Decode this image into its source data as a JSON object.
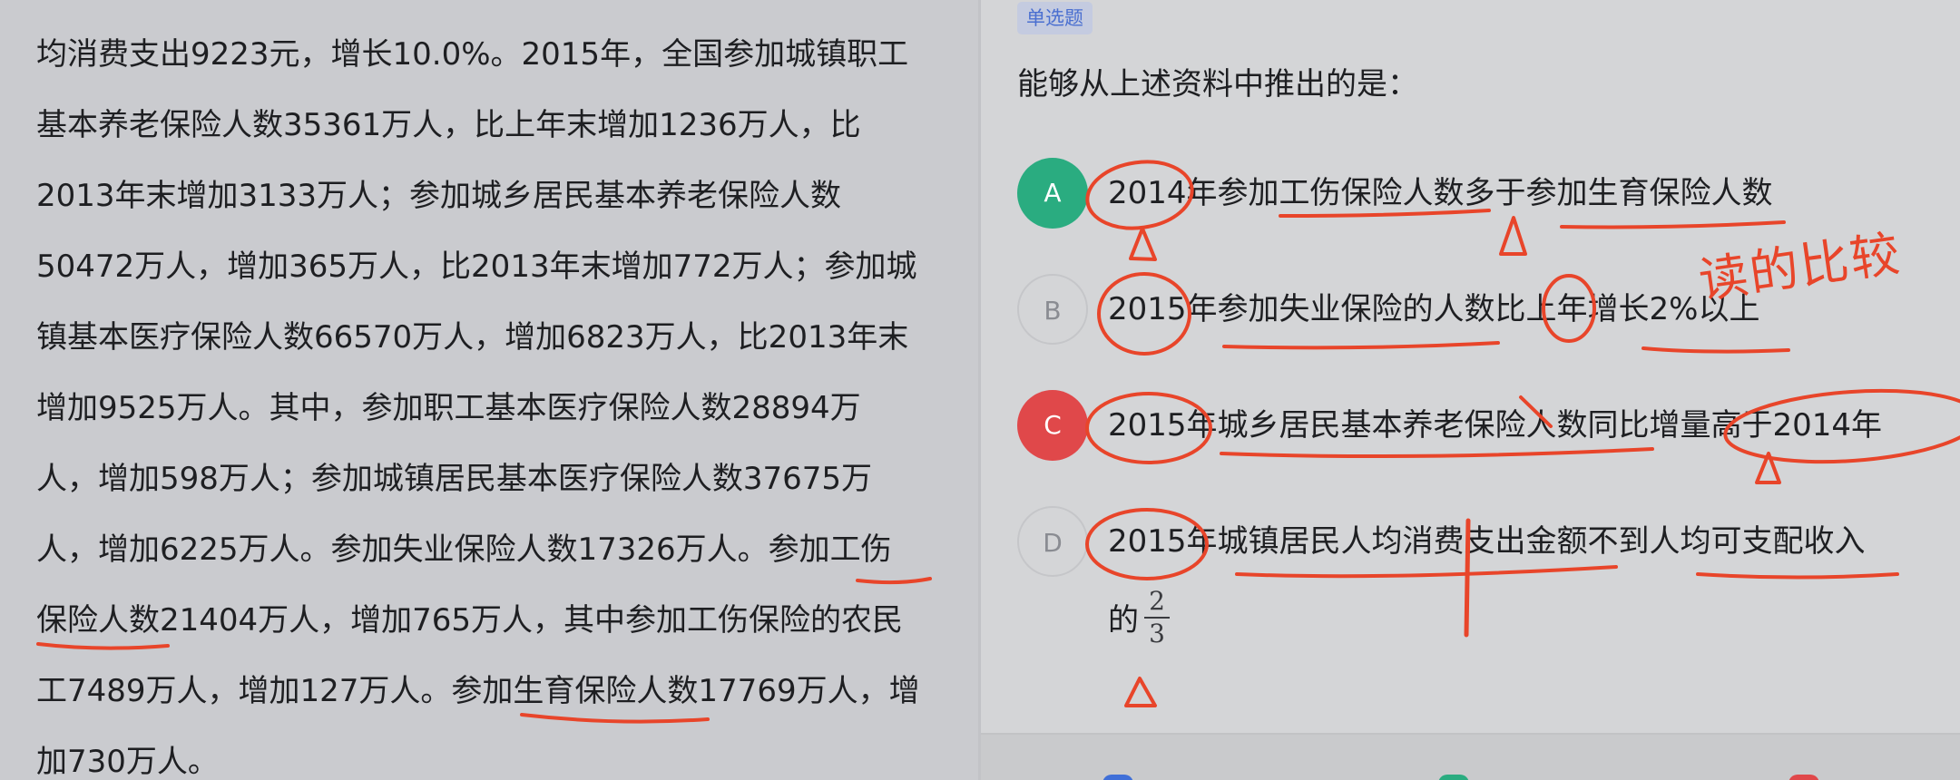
{
  "passage": {
    "lines": [
      "均消费支出9223元，增长10.0%。2015年，全国参加城镇职工",
      "基本养老保险人数35361万人，比上年末增加1236万人，比",
      "2013年末增加3133万人；参加城乡居民基本养老保险人数",
      "50472万人，增加365万人，比2013年末增加772万人；参加城",
      "镇基本医疗保险人数66570万人，增加6823万人，比2013年末",
      "增加9525万人。其中，参加职工基本医疗保险人数28894万",
      "人，增加598万人；参加城镇居民基本医疗保险人数37675万",
      "人，增加6225万人。参加失业保险人数17326万人。参加工伤",
      "保险人数21404万人，增加765万人，其中参加工伤保险的农民",
      "工7489万人，增加127万人。参加生育保险人数17769万人，增",
      "加730万人。"
    ]
  },
  "question_panel": {
    "type_tag": "单选题",
    "stem": "能够从上述资料中推出的是：",
    "options": [
      {
        "letter": "A",
        "text": "2014年参加工伤保险人数多于参加生育保险人数",
        "state": "correct"
      },
      {
        "letter": "B",
        "text": "2015年参加失业保险的人数比上年增长2%以上",
        "state": "normal"
      },
      {
        "letter": "C",
        "text": "2015年城乡居民基本养老保险人数同比增量高于2014年",
        "state": "wrong"
      },
      {
        "letter": "D",
        "text": "2015年城镇居民人均消费支出金额不到人均可支配收入",
        "state": "normal"
      }
    ],
    "option_d_suffix": "的",
    "fraction": {
      "numerator": "2",
      "denominator": "3"
    }
  },
  "handwriting": {
    "note": "读的比较"
  },
  "colors": {
    "correct": "#2aac80",
    "wrong": "#e0484a",
    "ink": "#e8452a",
    "tag_text": "#4a6fd0"
  }
}
